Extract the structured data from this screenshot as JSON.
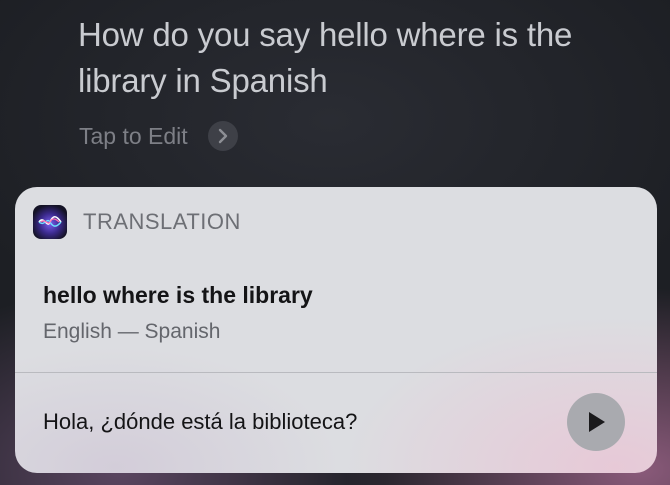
{
  "query": {
    "text": "How do you say hello where is the library in Spanish",
    "tap_to_edit_label": "Tap to Edit"
  },
  "card": {
    "header_label": "TRANSLATION",
    "source_text": "hello where is the library",
    "language_pair": "English — Spanish",
    "translated_text": "Hola, ¿dónde está la biblioteca?"
  },
  "icons": {
    "app": "siri-icon",
    "edit_chevron": "chevron-right-icon",
    "play": "play-icon"
  },
  "colors": {
    "background": "#1d1f24",
    "card": "#dcdde1",
    "query_text": "#c9cbd0"
  }
}
